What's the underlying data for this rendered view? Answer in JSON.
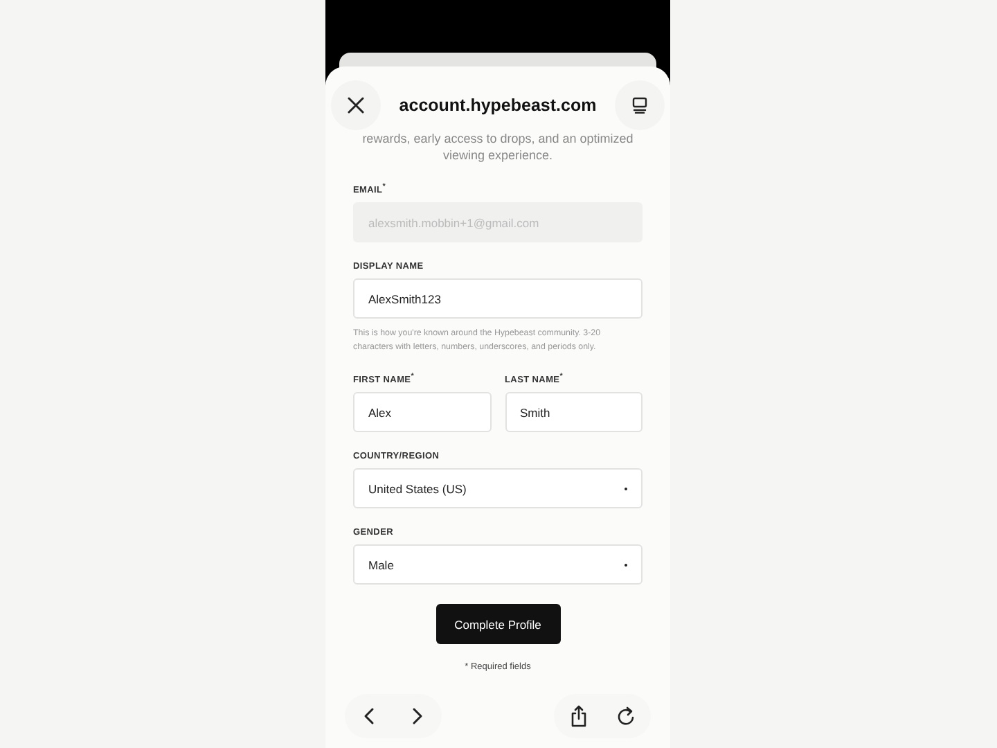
{
  "browser": {
    "url": "account.hypebeast.com"
  },
  "intro": "rewards, early access to drops, and an optimized viewing experience.",
  "form": {
    "fields": [
      {
        "kind": "input",
        "label": "EMAIL$^{*}$",
        "value": "alexsmith.mobbin+1@gmail.com",
        "disabled": true
      },
      {
        "kind": "input",
        "label": "DISPLAY NAME",
        "value": "AlexSmith123",
        "disabled": false,
        "hint": "This is how you're known around the Hypebeast community. 3-20 characters with letters, numbers, underscores, and periods only."
      },
      {
        "kind": "pair",
        "items": [
          {
            "label": "FIRST NAME$^{*}$",
            "value": "Alex"
          },
          {
            "label": "LAST NAME$^{*}$",
            "value": "Smith"
          }
        ]
      },
      {
        "kind": "select",
        "label": "COUNTRY/REGION",
        "value": "United States (US)"
      },
      {
        "kind": "select",
        "label": "GENDER",
        "value": "Male"
      }
    ],
    "submit": "Complete Profile",
    "note": "* Required fields"
  }
}
